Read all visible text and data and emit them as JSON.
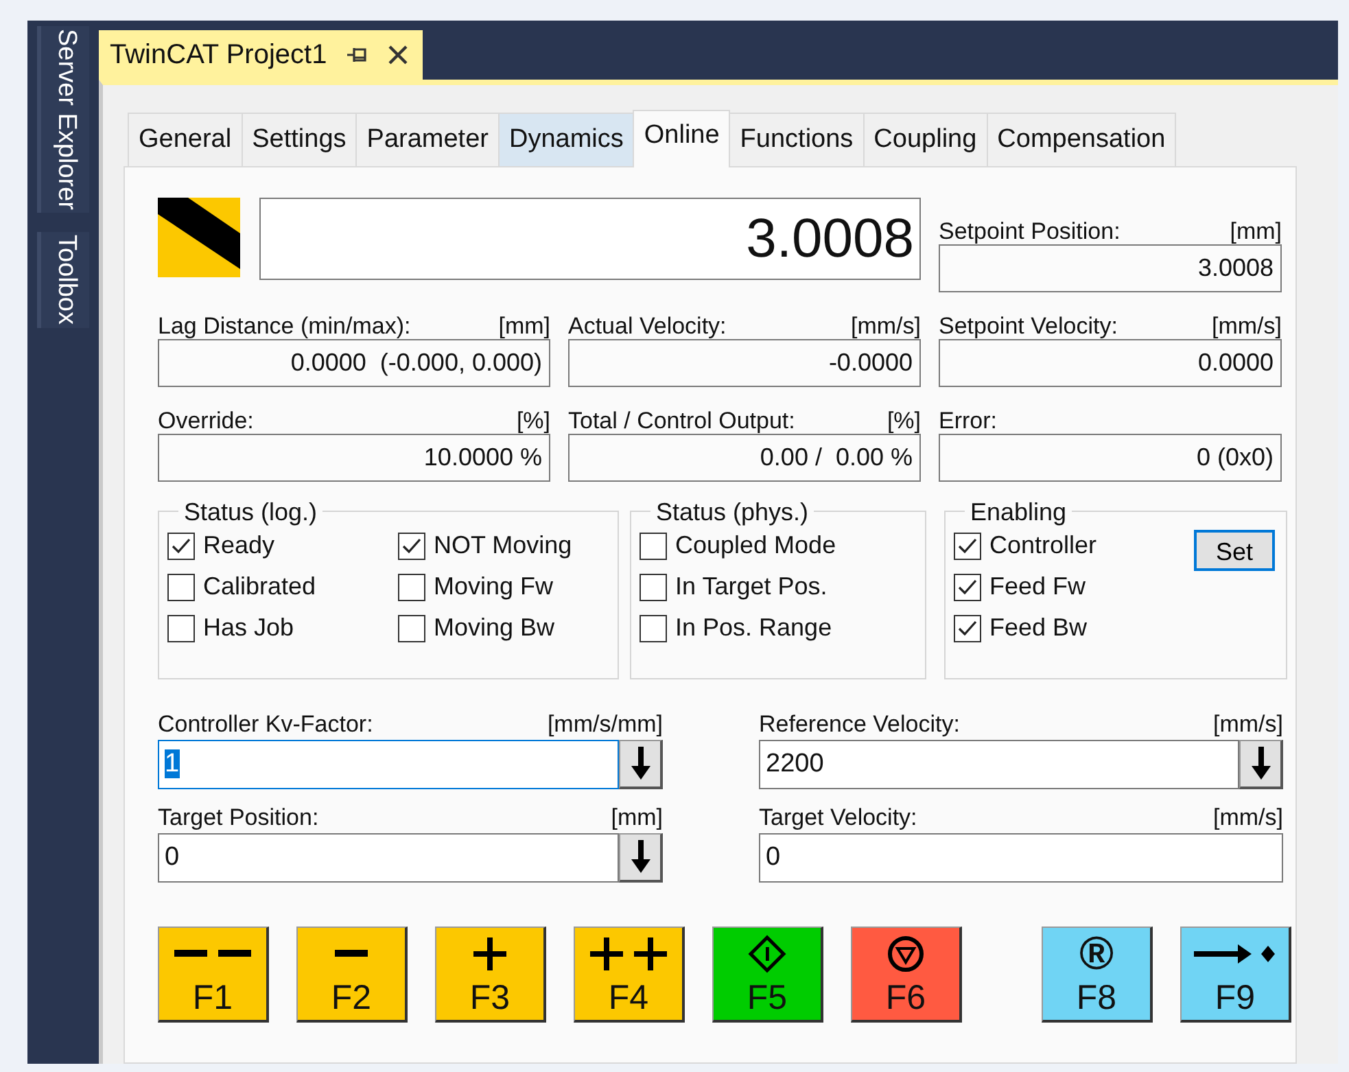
{
  "sidebar": {
    "items": [
      {
        "label": "Server Explorer"
      },
      {
        "label": "Toolbox"
      }
    ]
  },
  "document_tab": {
    "title": "TwinCAT Project1"
  },
  "tabs": [
    {
      "label": "General",
      "selected": false,
      "hovered": false
    },
    {
      "label": "Settings",
      "selected": false,
      "hovered": false
    },
    {
      "label": "Parameter",
      "selected": false,
      "hovered": false
    },
    {
      "label": "Dynamics",
      "selected": false,
      "hovered": true
    },
    {
      "label": "Online",
      "selected": true,
      "hovered": false
    },
    {
      "label": "Functions",
      "selected": false,
      "hovered": false
    },
    {
      "label": "Coupling",
      "selected": false,
      "hovered": false
    },
    {
      "label": "Compensation",
      "selected": false,
      "hovered": false
    }
  ],
  "display": {
    "value": "3.0008"
  },
  "readouts": [
    {
      "label": "Setpoint Position:",
      "unit": "[mm]",
      "value": "3.0008"
    },
    {
      "label": "Lag Distance (min/max):",
      "unit": "[mm]",
      "value": "0.0000  (-0.000, 0.000)"
    },
    {
      "label": "Actual Velocity:",
      "unit": "[mm/s]",
      "value": "-0.0000"
    },
    {
      "label": "Setpoint Velocity:",
      "unit": "[mm/s]",
      "value": "0.0000"
    },
    {
      "label": "Override:",
      "unit": "[%]",
      "value": "10.0000 %"
    },
    {
      "label": "Total / Control Output:",
      "unit": "[%]",
      "value": "0.00 /  0.00 %"
    },
    {
      "label": "Error:",
      "value": "0 (0x0)"
    }
  ],
  "groups": [
    {
      "title": "Status (log.)",
      "items": [
        {
          "label": "Ready",
          "checked": true
        },
        {
          "label": "NOT Moving",
          "checked": true
        },
        {
          "label": "Calibrated",
          "checked": false
        },
        {
          "label": "Moving Fw",
          "checked": false
        },
        {
          "label": "Has Job",
          "checked": false
        },
        {
          "label": "Moving Bw",
          "checked": false
        }
      ]
    },
    {
      "title": "Status (phys.)",
      "items": [
        {
          "label": "Coupled Mode",
          "checked": false
        },
        {
          "label": "In Target Pos.",
          "checked": false
        },
        {
          "label": "In Pos. Range",
          "checked": false
        }
      ]
    },
    {
      "title": "Enabling",
      "items": [
        {
          "label": "Controller",
          "checked": true
        },
        {
          "label": "Feed Fw",
          "checked": true
        },
        {
          "label": "Feed Bw",
          "checked": true
        }
      ],
      "button": {
        "label": "Set",
        "focused": true
      }
    }
  ],
  "inputs": [
    {
      "label": "Controller Kv-Factor:",
      "unit": "[mm/s/mm]",
      "value": "1",
      "focused": true,
      "apply_button": true
    },
    {
      "label": "Reference Velocity:",
      "unit": "[mm/s]",
      "value": "2200",
      "focused": false,
      "apply_button": true
    },
    {
      "label": "Target Position:",
      "unit": "[mm]",
      "value": "0",
      "focused": false,
      "apply_button": true
    },
    {
      "label": "Target Velocity:",
      "unit": "[mm/s]",
      "value": "0",
      "focused": false,
      "apply_button": false
    }
  ],
  "jog_buttons": [
    {
      "key": "F1",
      "kind": "minus2",
      "color": "#fcc800"
    },
    {
      "key": "F2",
      "kind": "minus",
      "color": "#fcc800"
    },
    {
      "key": "F3",
      "kind": "plus",
      "color": "#fcc800"
    },
    {
      "key": "F4",
      "kind": "plus2",
      "color": "#fcc800"
    },
    {
      "key": "F5",
      "kind": "start",
      "color": "#00cc00"
    },
    {
      "key": "F6",
      "kind": "stop",
      "color": "#ff5a41"
    }
  ],
  "reference_buttons": [
    {
      "key": "F8",
      "kind": "glyph",
      "symbol": "®",
      "color": "#70d4f4"
    },
    {
      "key": "F9",
      "kind": "forward",
      "color": "#70d4f4"
    }
  ]
}
